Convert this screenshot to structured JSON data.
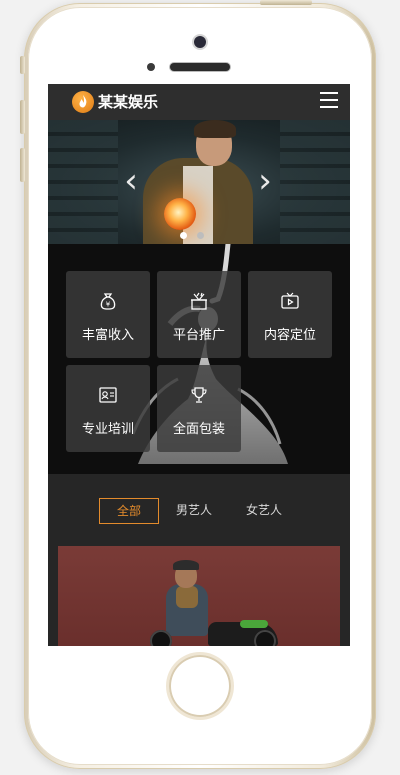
{
  "header": {
    "brand": "某某娱乐",
    "logo_icon": "flame-icon",
    "menu_icon": "hamburger-menu-icon",
    "accent_color": "#e38b2c"
  },
  "banner": {
    "prev_icon": "chevron-left-icon",
    "next_icon": "chevron-right-icon",
    "prev_glyph": "‹",
    "next_glyph": "›",
    "slide_count": 3,
    "active_slide": 1
  },
  "services": {
    "items": [
      {
        "label": "丰富收入",
        "icon": "money-bag-icon"
      },
      {
        "label": "平台推广",
        "icon": "gift-box-icon"
      },
      {
        "label": "内容定位",
        "icon": "tv-play-icon"
      },
      {
        "label": "专业培训",
        "icon": "certificate-icon"
      },
      {
        "label": "全面包装",
        "icon": "trophy-icon"
      }
    ]
  },
  "filter_tabs": {
    "items": [
      {
        "label": "全部",
        "active": true
      },
      {
        "label": "男艺人",
        "active": false
      },
      {
        "label": "女艺人",
        "active": false
      }
    ]
  }
}
